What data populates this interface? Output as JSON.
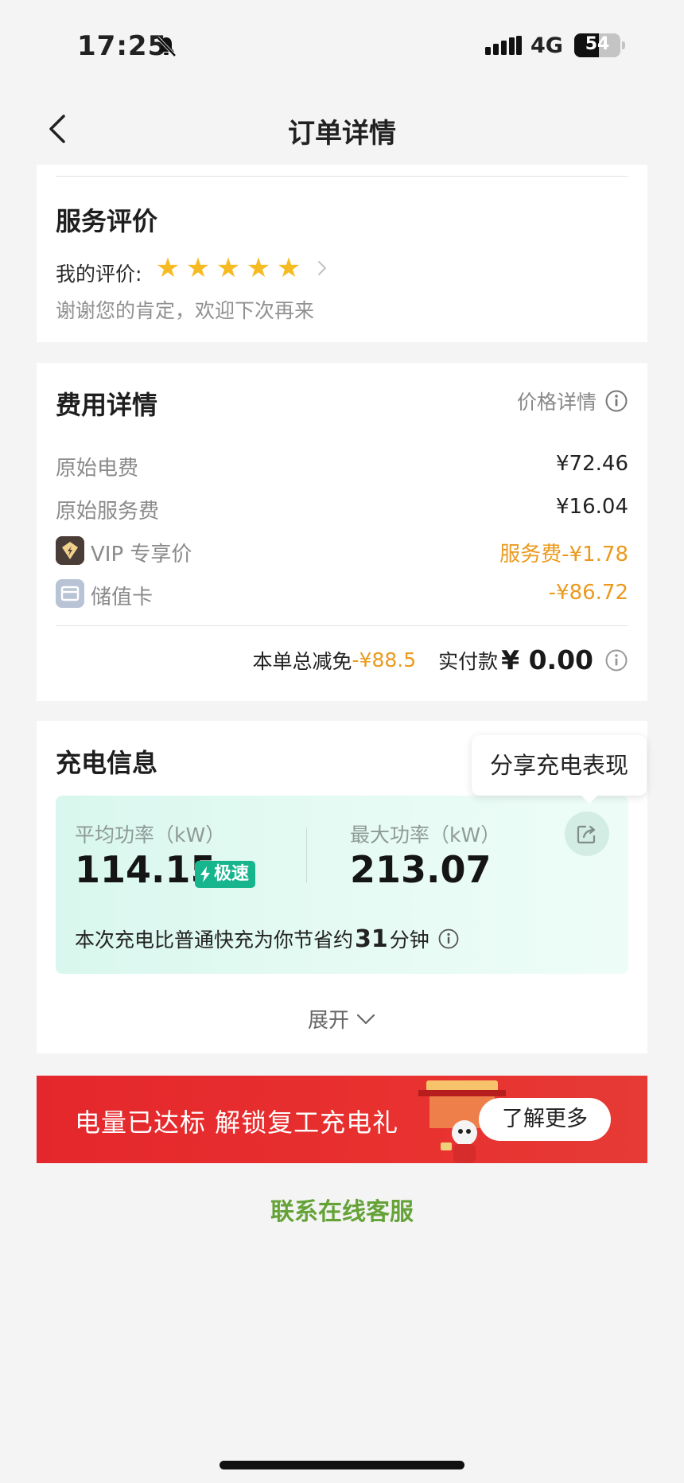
{
  "status_bar": {
    "time": "17:25",
    "network": "4G",
    "battery_level": "54",
    "battery_fraction": 0.54,
    "icons": [
      "bell-muted-icon",
      "signal-icon"
    ]
  },
  "nav": {
    "title": "订单详情",
    "back_icon": "chevron-left-icon"
  },
  "rating": {
    "title": "服务评价",
    "label": "我的评价:",
    "stars": 5,
    "max_stars": 5,
    "comment": "谢谢您的肯定，欢迎下次再来"
  },
  "fees": {
    "title": "费用详情",
    "price_detail_label": "价格详情",
    "rows": [
      {
        "label": "原始电费",
        "value": "¥72.46"
      },
      {
        "label": "原始服务费",
        "value": "¥16.04"
      },
      {
        "label": "VIP 专享价",
        "value": "服务费-¥1.78"
      },
      {
        "label": "储值卡",
        "value": "-¥86.72"
      }
    ],
    "total_discount_label": "本单总减免",
    "total_discount_value": "-¥88.5",
    "paid_label": "实付款",
    "paid_value": "¥ 0.00"
  },
  "charging": {
    "title": "充电信息",
    "tooltip": "分享充电表现",
    "avg_power_label": "平均功率（kW）",
    "avg_power_value": "114.15",
    "speed_badge": "极速",
    "max_power_label": "最大功率（kW）",
    "max_power_value": "213.07",
    "saving_prefix": "本次充电比普通快充为你节省约",
    "saving_minutes": "31",
    "saving_suffix": "分钟",
    "expand_label": "展开"
  },
  "banner": {
    "text": "电量已达标 解锁复工充电礼",
    "button": "了解更多"
  },
  "contact": {
    "label": "联系在线客服"
  },
  "colors": {
    "accent_orange": "#eb9a1e",
    "star_yellow": "#f6bb23",
    "badge_green": "#17b58d",
    "link_green": "#65a338",
    "banner_red": "#e4272c"
  }
}
